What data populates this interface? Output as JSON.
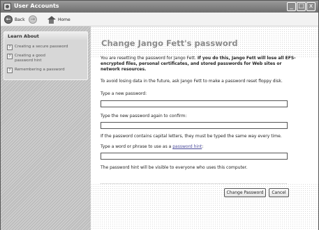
{
  "window": {
    "title": "User Accounts"
  },
  "title_buttons": {
    "minimize": "_",
    "maximize": "□",
    "close": "x"
  },
  "toolbar": {
    "back_label": "Back",
    "home_label": "Home"
  },
  "sidebar": {
    "heading": "Learn About",
    "items": [
      {
        "label": "Creating a secure password",
        "icon": "help-icon"
      },
      {
        "label": "Creating a good password hint",
        "icon": "help-icon"
      },
      {
        "label": "Remembering a password",
        "icon": "help-icon"
      }
    ]
  },
  "main": {
    "title": "Change Jango Fett's password",
    "warning_intro": "You are resetting the password for Jango Fett.",
    "warning_bold": "If you do this, Jango Fett will lose all EFS-encrypted files, personal certificates, and stored passwords for Web sites or network resources.",
    "info": "To avoid losing data in the future, ask Jango Fett to make a password reset floppy disk.",
    "new_password_label": "Type a new password:",
    "confirm_label": "Type the new password again to confirm:",
    "case_note": "If the password contains capital letters, they must be typed the same way every time.",
    "hint_label_prefix": "Type a word or phrase to use as a",
    "hint_link": "password hint",
    "hint_label_suffix": ":",
    "hint_note": "The password hint will be visible to everyone who uses this computer.",
    "new_password_value": "",
    "confirm_value": "",
    "hint_value": ""
  },
  "buttons": {
    "change": "Change Password",
    "cancel": "Cancel"
  }
}
